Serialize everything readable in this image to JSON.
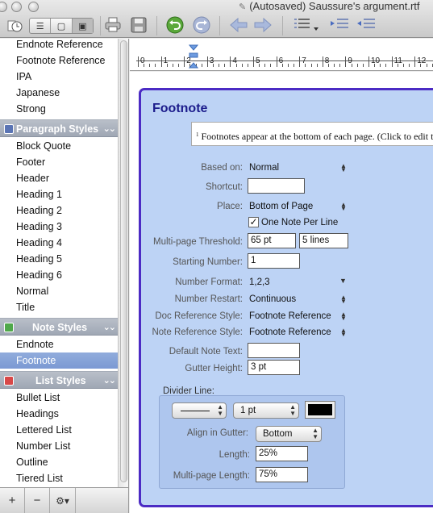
{
  "window": {
    "title": "(Autosaved) Saussure's argument.rtf"
  },
  "toolbar": {
    "buttons": [
      "clock-icon",
      "view-list-icon",
      "view-page-icon",
      "view-full-icon",
      "print-icon",
      "save-icon",
      "undo-icon",
      "redo-icon",
      "back-icon",
      "forward-icon",
      "list-icon",
      "indent-icon",
      "outdent-icon"
    ]
  },
  "sidebar": {
    "char_items": [
      "Endnote Reference",
      "Footnote Reference",
      "IPA",
      "Japanese",
      "Strong"
    ],
    "paragraph_header": "Paragraph Styles",
    "paragraph_items": [
      "Block Quote",
      "Footer",
      "Header",
      "Heading 1",
      "Heading 2",
      "Heading 3",
      "Heading 4",
      "Heading 5",
      "Heading 6",
      "Normal",
      "Title"
    ],
    "note_header": "Note Styles",
    "note_items": [
      "Endnote",
      "Footnote"
    ],
    "list_header": "List Styles",
    "list_items": [
      "Bullet List",
      "Headings",
      "Lettered List",
      "Number List",
      "Outline",
      "Tiered List"
    ],
    "selected": "Footnote"
  },
  "bottom_bar": {
    "add": "+",
    "remove": "−",
    "action": "⚙▾"
  },
  "ruler": {
    "numbers": [
      "0",
      "1",
      "2",
      "3",
      "4",
      "5",
      "6",
      "7",
      "8",
      "9",
      "10",
      "11",
      "12"
    ]
  },
  "style_panel": {
    "title": "Footnote",
    "preview_mark": "1",
    "preview_text": "Footnotes appear at the bottom of each page. (Click to edit this text.)",
    "based_on_label": "Based on:",
    "based_on_value": "Normal",
    "shortcut_label": "Shortcut:",
    "shortcut_value": "",
    "place_label": "Place:",
    "place_value": "Bottom of Page",
    "one_note_label": "One Note Per Line",
    "one_note_checked": "✓",
    "threshold_label": "Multi-page Threshold:",
    "threshold_value": "65 pt",
    "threshold_lines": "5 lines",
    "starting_number_label": "Starting Number:",
    "starting_number_value": "1",
    "number_format_label": "Number Format:",
    "number_format_value": "1,2,3",
    "number_restart_label": "Number Restart:",
    "number_restart_value": "Continuous",
    "doc_ref_label": "Doc Reference Style:",
    "doc_ref_value": "Footnote Reference",
    "note_ref_label": "Note Reference Style:",
    "note_ref_value": "Footnote Reference",
    "default_text_label": "Default Note Text:",
    "default_text_value": "",
    "gutter_height_label": "Gutter Height:",
    "gutter_height_value": "3 pt",
    "divider_label": "Divider Line:",
    "divider_weight": "1 pt",
    "divider_color": "#000000",
    "align_label": "Align in Gutter:",
    "align_value": "Bottom",
    "length_label": "Length:",
    "length_value": "25%",
    "mp_length_label": "Multi-page Length:",
    "mp_length_value": "75%"
  },
  "colors": {
    "panel_bg": "#bdd3f5",
    "panel_border": "#4b2bc4",
    "selection": "#7b99d3",
    "section_header": "#a3abb8"
  }
}
